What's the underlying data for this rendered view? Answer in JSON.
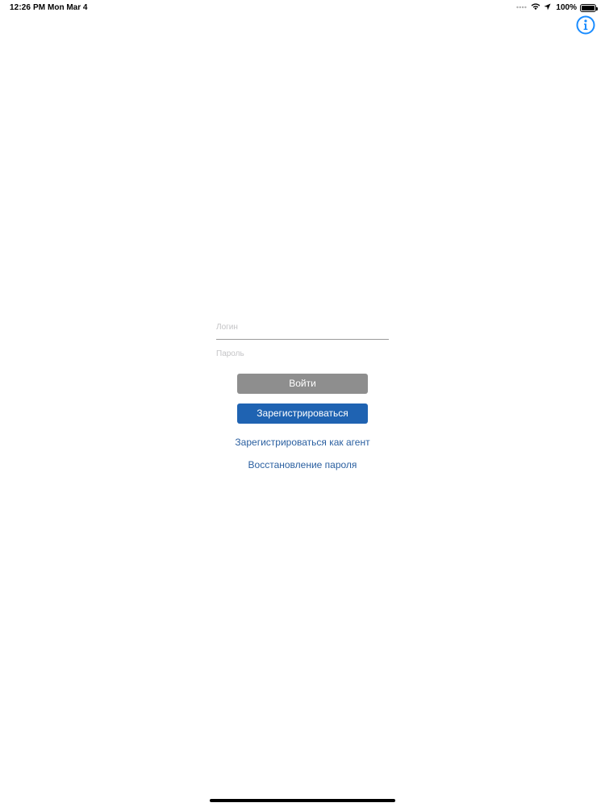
{
  "status_bar": {
    "time": "12:26 PM",
    "date": "Mon Mar 4",
    "battery_percent": "100%",
    "battery_level": 1.0,
    "icons": [
      "signal-dots-icon",
      "wifi-icon",
      "location-arrow-icon",
      "battery-icon"
    ]
  },
  "header": {
    "info_icon": "info-circle-icon",
    "accent_color": "#1a8cff"
  },
  "form": {
    "login": {
      "placeholder": "Логин",
      "value": ""
    },
    "password": {
      "placeholder": "Пароль",
      "value": ""
    }
  },
  "buttons": {
    "login_label": "Войти",
    "register_label": "Зарегистрироваться",
    "login_color": "#8e8e8e",
    "register_color": "#1f63b2"
  },
  "links": {
    "register_agent": "Зарегистрироваться как агент",
    "password_recovery": "Восстановление пароля",
    "link_color": "#2a5fa0"
  }
}
